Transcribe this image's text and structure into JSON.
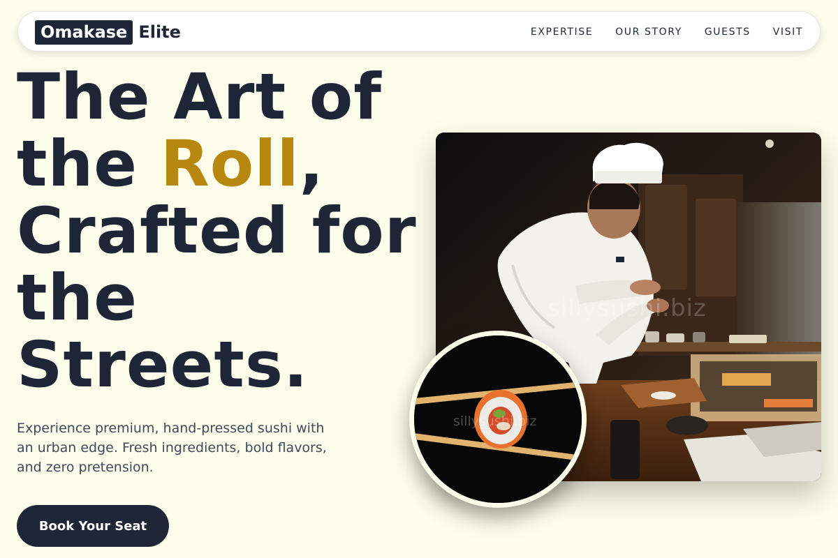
{
  "brand": {
    "logo_box_text": "Omakase",
    "logo_rest_text": "Elite"
  },
  "nav": {
    "links": [
      "EXPERTISE",
      "OUR STORY",
      "GUESTS",
      "VISIT"
    ]
  },
  "hero": {
    "headline_part1": "The Art of the ",
    "headline_accent": "Roll",
    "headline_part2": ", Crafted for the Streets.",
    "subtext": "Experience premium, hand-pressed sushi with an urban edge. Fresh ingredients, bold flavors, and zero pretension.",
    "cta_label": "Book Your Seat"
  },
  "images": {
    "main_photo_watermark": "sillysushi.biz",
    "inset_photo_watermark": "sillysushi.biz"
  },
  "colors": {
    "background": "#fdfdec",
    "navy": "#1d2536",
    "accent_gold": "#b8870f",
    "body_text": "#3e4a5c"
  }
}
